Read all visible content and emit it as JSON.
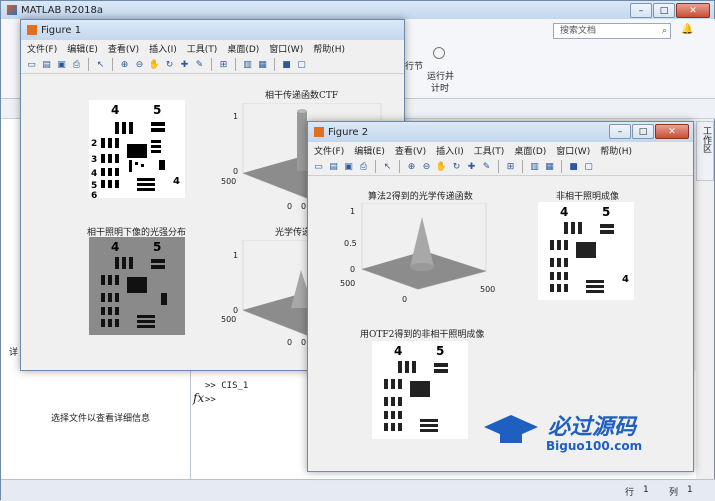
{
  "main": {
    "title": "MATLAB R2018a",
    "search_placeholder": "搜索文档",
    "ribbon_items": [
      "行节",
      "运行并",
      "计时"
    ],
    "panel_label": "详",
    "panel_message": "选择文件以查看详细信息",
    "command_lines": [
      ">> CIS_1",
      ">>"
    ],
    "fx_symbol": "fx",
    "status": {
      "row_label": "行",
      "row": "1",
      "col_label": "列",
      "col": "1"
    },
    "side_tab": "工作区"
  },
  "menu": [
    "文件(F)",
    "编辑(E)",
    "查看(V)",
    "插入(I)",
    "工具(T)",
    "桌面(D)",
    "窗口(W)",
    "帮助(H)"
  ],
  "figure1": {
    "title": "Figure 1",
    "subplots": {
      "s2": "相干传递函数CTF",
      "s3": "相干照明下像的光强分布",
      "s4": "光学传递函数"
    },
    "ticks": {
      "z1": "1",
      "z0": "0",
      "x500": "500",
      "x0a": "0",
      "x0b": "0",
      "z1b": "1",
      "z0b": "0",
      "x500b": "500",
      "x0c": "0",
      "x0d": "0"
    }
  },
  "figure2": {
    "title": "Figure 2",
    "subplots": {
      "s1": "算法2得到的光学传递函数",
      "s2": "非相干照明成像",
      "s3": "用OTF2得到的非相干照明成像"
    },
    "ticks": {
      "z1": "1",
      "z05": "0.5",
      "z0": "0",
      "x500": "500",
      "x0a": "0",
      "x0b": "0",
      "y500": "500"
    }
  },
  "target_digits": {
    "d4": "4",
    "d5": "5",
    "d2": "2",
    "d3": "3",
    "d6": "6"
  },
  "watermark": {
    "cn": "必过源码",
    "url": "Biguo100.com"
  },
  "colors": {
    "titlebar": "#c3d7ee",
    "surface": "#8c8c8c",
    "watermark": "#1e5fc0"
  }
}
